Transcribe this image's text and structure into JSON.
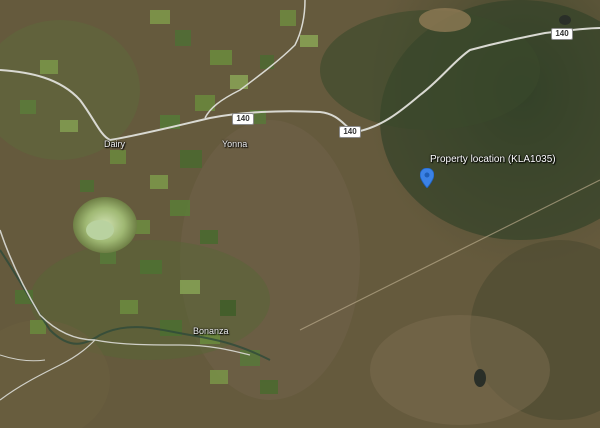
{
  "map": {
    "type": "satellite",
    "highway_shields": [
      "140",
      "140",
      "140"
    ],
    "towns": [
      "Dairy",
      "Yonna",
      "Bonanza"
    ],
    "marker": {
      "label": "Property location (KLA1035)",
      "color": "#3b82e6"
    }
  }
}
